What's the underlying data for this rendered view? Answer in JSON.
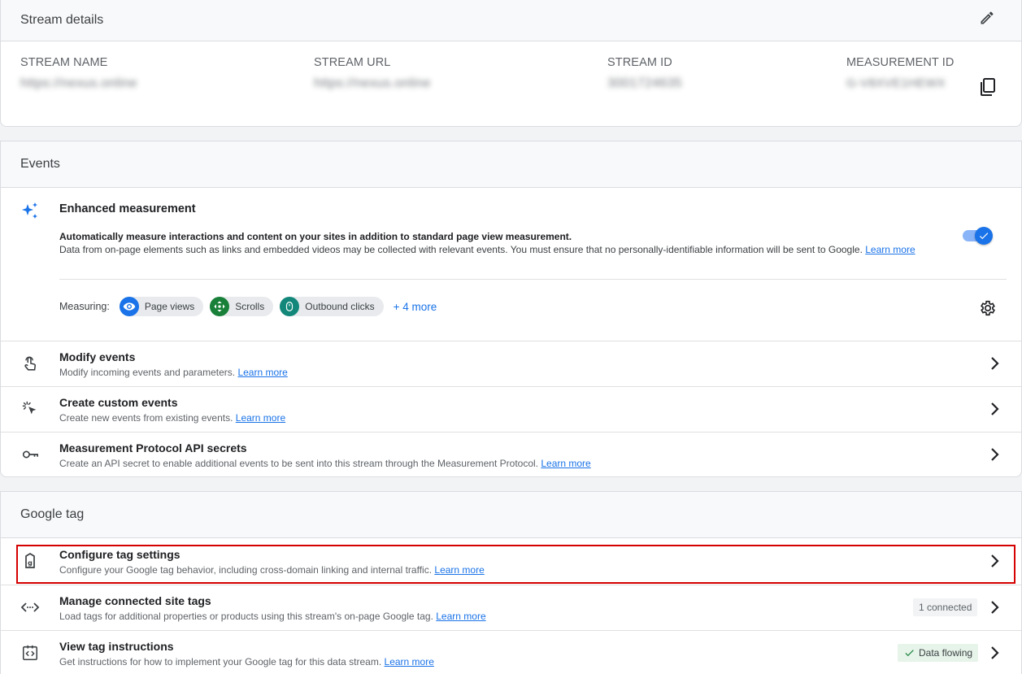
{
  "stream_details": {
    "title": "Stream details",
    "fields": [
      {
        "label": "STREAM NAME",
        "value": "https://nexus.online"
      },
      {
        "label": "STREAM URL",
        "value": "https://nexus.online"
      },
      {
        "label": "STREAM ID",
        "value": "3001724635"
      },
      {
        "label": "MEASUREMENT ID",
        "value": "G-V8XVE1HEWX"
      }
    ]
  },
  "events": {
    "title": "Events",
    "enhanced": {
      "title": "Enhanced measurement",
      "desc_line1": "Automatically measure interactions and content on your sites in addition to standard page view measurement.",
      "desc_line2": "Data from on-page elements such as links and embedded videos may be collected with relevant events. You must ensure that no personally-identifiable information will be sent to Google.",
      "learn_more": "Learn more",
      "toggle_on": true,
      "measuring_label": "Measuring:",
      "chips": [
        {
          "label": "Page views",
          "color": "#1a73e8",
          "icon": "eye-icon"
        },
        {
          "label": "Scrolls",
          "color": "#188038",
          "icon": "scroll-arrows-icon"
        },
        {
          "label": "Outbound clicks",
          "color": "#12877a",
          "icon": "mouse-icon"
        }
      ],
      "more_label": "+ 4 more"
    },
    "rows": [
      {
        "title": "Modify events",
        "desc": "Modify incoming events and parameters.",
        "link": "Learn more",
        "icon": "touch-icon"
      },
      {
        "title": "Create custom events",
        "desc": "Create new events from existing events.",
        "link": "Learn more",
        "icon": "cursor-click-icon"
      },
      {
        "title": "Measurement Protocol API secrets",
        "desc": "Create an API secret to enable additional events to be sent into this stream through the Measurement Protocol.",
        "link": "Learn more",
        "icon": "key-icon"
      }
    ]
  },
  "google_tag": {
    "title": "Google tag",
    "rows": [
      {
        "title": "Configure tag settings",
        "desc": "Configure your Google tag behavior, including cross-domain linking and internal traffic.",
        "link": "Learn more",
        "icon": "tag-icon"
      },
      {
        "title": "Manage connected site tags",
        "desc": "Load tags for additional properties or products using this stream's on-page Google tag.",
        "link": "Learn more",
        "icon": "code-arrows-icon",
        "badge": "1 connected"
      },
      {
        "title": "View tag instructions",
        "desc": "Get instructions for how to implement your Google tag for this data stream.",
        "link": "Learn more",
        "icon": "code-doc-icon",
        "badge": "Data flowing"
      }
    ]
  }
}
